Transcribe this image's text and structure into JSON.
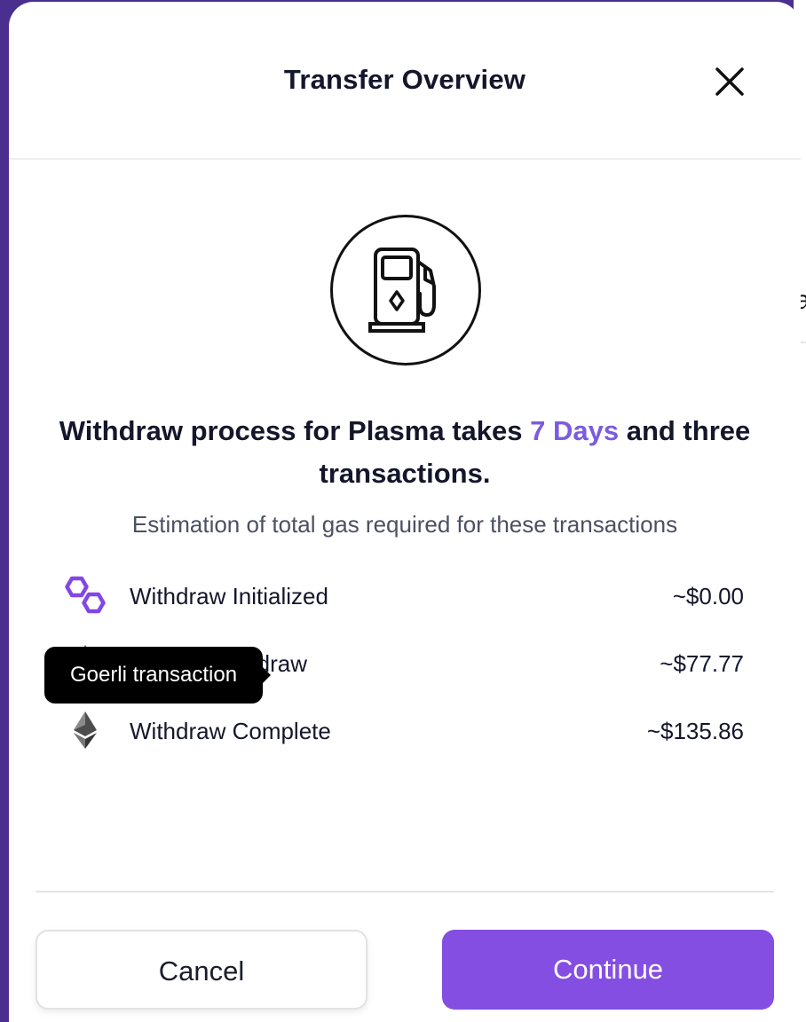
{
  "modal": {
    "title": "Transfer Overview",
    "icon": "gas-pump-icon"
  },
  "headline": {
    "prefix": "Withdraw process for Plasma takes ",
    "highlight": "7 Days",
    "suffix": " and three transactions."
  },
  "subtitle": "Estimation of total gas required for these transactions",
  "transactions": [
    {
      "label": "Withdraw Initialized",
      "amount": "~$0.00",
      "icon": "polygon-icon"
    },
    {
      "label": "Checkpoint Withdraw",
      "visible_label": "thdraw",
      "amount": "~$77.77",
      "icon": "ethereum-icon"
    },
    {
      "label": "Withdraw Complete",
      "amount": "~$135.86",
      "icon": "ethereum-icon"
    }
  ],
  "tooltip": "Goerli transaction",
  "buttons": {
    "cancel": "Cancel",
    "continue": "Continue"
  },
  "colors": {
    "accent": "#7b5be0",
    "primary_button": "#844ee2",
    "polygon": "#8247e5",
    "backdrop": "#4a2f8f"
  }
}
